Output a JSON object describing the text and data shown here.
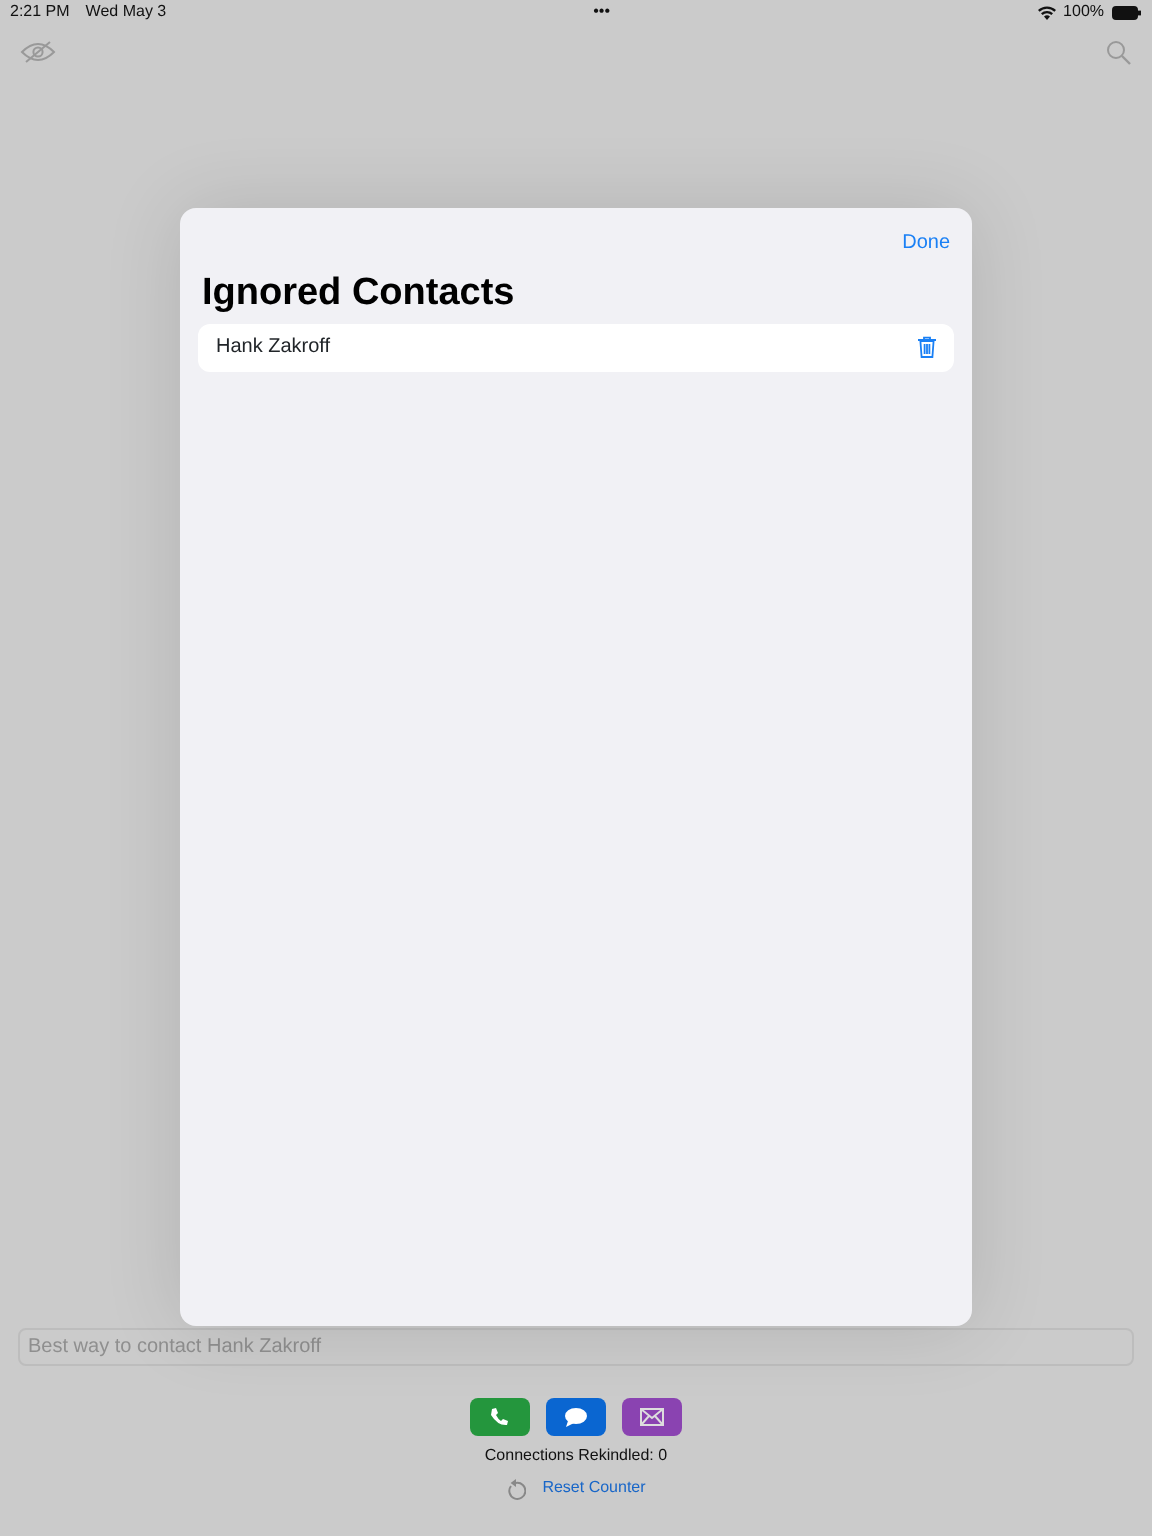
{
  "status_bar": {
    "time": "2:21 PM",
    "date": "Wed May 3",
    "dots": "•••",
    "battery": "100%"
  },
  "contact_field": {
    "placeholder": "Best way to contact Hank Zakroff"
  },
  "actions": [
    {
      "kind": "call",
      "color": "#24963d"
    },
    {
      "kind": "message",
      "color": "#0a66d1"
    },
    {
      "kind": "mail",
      "color": "#8a43b1"
    }
  ],
  "counter": "Connections Rekindled: 0",
  "reset_link": "Reset Counter",
  "sheet": {
    "done": "Done",
    "title": "Ignored Contacts",
    "contacts": [
      {
        "name": "Hank Zakroff"
      }
    ]
  }
}
